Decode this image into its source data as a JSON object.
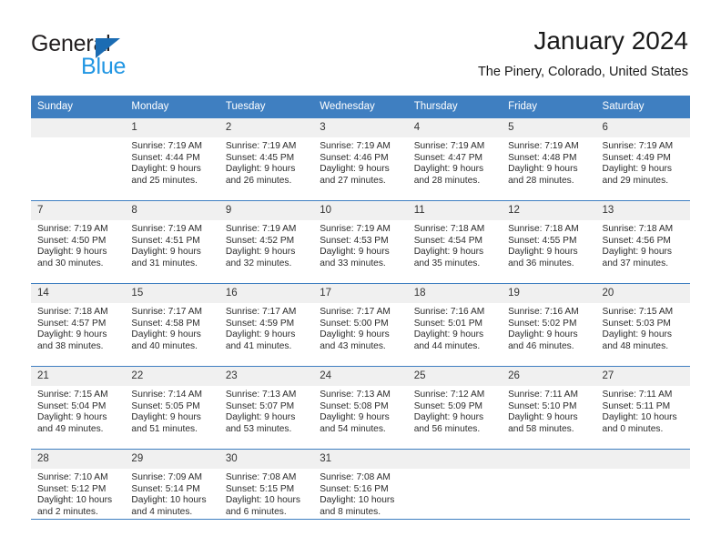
{
  "brand": {
    "name_top": "General",
    "name_bottom": "Blue",
    "accent_color": "#1b6cb3",
    "blue_text_color": "#2196e3"
  },
  "header": {
    "title": "January 2024",
    "subtitle": "The Pinery, Colorado, United States"
  },
  "theme": {
    "header_row_color": "#3f7fc1",
    "daynum_band_color": "#f0f0f0",
    "grid_line_color": "#3f7fc1",
    "text_color": "#2b2b2b"
  },
  "weekday_headers": [
    "Sunday",
    "Monday",
    "Tuesday",
    "Wednesday",
    "Thursday",
    "Friday",
    "Saturday"
  ],
  "weeks": [
    [
      {
        "day": "",
        "sunrise": "",
        "sunset": "",
        "daylight_line1": "",
        "daylight_line2": "",
        "empty": true
      },
      {
        "day": "1",
        "sunrise": "Sunrise: 7:19 AM",
        "sunset": "Sunset: 4:44 PM",
        "daylight_line1": "Daylight: 9 hours",
        "daylight_line2": "and 25 minutes."
      },
      {
        "day": "2",
        "sunrise": "Sunrise: 7:19 AM",
        "sunset": "Sunset: 4:45 PM",
        "daylight_line1": "Daylight: 9 hours",
        "daylight_line2": "and 26 minutes."
      },
      {
        "day": "3",
        "sunrise": "Sunrise: 7:19 AM",
        "sunset": "Sunset: 4:46 PM",
        "daylight_line1": "Daylight: 9 hours",
        "daylight_line2": "and 27 minutes."
      },
      {
        "day": "4",
        "sunrise": "Sunrise: 7:19 AM",
        "sunset": "Sunset: 4:47 PM",
        "daylight_line1": "Daylight: 9 hours",
        "daylight_line2": "and 28 minutes."
      },
      {
        "day": "5",
        "sunrise": "Sunrise: 7:19 AM",
        "sunset": "Sunset: 4:48 PM",
        "daylight_line1": "Daylight: 9 hours",
        "daylight_line2": "and 28 minutes."
      },
      {
        "day": "6",
        "sunrise": "Sunrise: 7:19 AM",
        "sunset": "Sunset: 4:49 PM",
        "daylight_line1": "Daylight: 9 hours",
        "daylight_line2": "and 29 minutes."
      }
    ],
    [
      {
        "day": "7",
        "sunrise": "Sunrise: 7:19 AM",
        "sunset": "Sunset: 4:50 PM",
        "daylight_line1": "Daylight: 9 hours",
        "daylight_line2": "and 30 minutes."
      },
      {
        "day": "8",
        "sunrise": "Sunrise: 7:19 AM",
        "sunset": "Sunset: 4:51 PM",
        "daylight_line1": "Daylight: 9 hours",
        "daylight_line2": "and 31 minutes."
      },
      {
        "day": "9",
        "sunrise": "Sunrise: 7:19 AM",
        "sunset": "Sunset: 4:52 PM",
        "daylight_line1": "Daylight: 9 hours",
        "daylight_line2": "and 32 minutes."
      },
      {
        "day": "10",
        "sunrise": "Sunrise: 7:19 AM",
        "sunset": "Sunset: 4:53 PM",
        "daylight_line1": "Daylight: 9 hours",
        "daylight_line2": "and 33 minutes."
      },
      {
        "day": "11",
        "sunrise": "Sunrise: 7:18 AM",
        "sunset": "Sunset: 4:54 PM",
        "daylight_line1": "Daylight: 9 hours",
        "daylight_line2": "and 35 minutes."
      },
      {
        "day": "12",
        "sunrise": "Sunrise: 7:18 AM",
        "sunset": "Sunset: 4:55 PM",
        "daylight_line1": "Daylight: 9 hours",
        "daylight_line2": "and 36 minutes."
      },
      {
        "day": "13",
        "sunrise": "Sunrise: 7:18 AM",
        "sunset": "Sunset: 4:56 PM",
        "daylight_line1": "Daylight: 9 hours",
        "daylight_line2": "and 37 minutes."
      }
    ],
    [
      {
        "day": "14",
        "sunrise": "Sunrise: 7:18 AM",
        "sunset": "Sunset: 4:57 PM",
        "daylight_line1": "Daylight: 9 hours",
        "daylight_line2": "and 38 minutes."
      },
      {
        "day": "15",
        "sunrise": "Sunrise: 7:17 AM",
        "sunset": "Sunset: 4:58 PM",
        "daylight_line1": "Daylight: 9 hours",
        "daylight_line2": "and 40 minutes."
      },
      {
        "day": "16",
        "sunrise": "Sunrise: 7:17 AM",
        "sunset": "Sunset: 4:59 PM",
        "daylight_line1": "Daylight: 9 hours",
        "daylight_line2": "and 41 minutes."
      },
      {
        "day": "17",
        "sunrise": "Sunrise: 7:17 AM",
        "sunset": "Sunset: 5:00 PM",
        "daylight_line1": "Daylight: 9 hours",
        "daylight_line2": "and 43 minutes."
      },
      {
        "day": "18",
        "sunrise": "Sunrise: 7:16 AM",
        "sunset": "Sunset: 5:01 PM",
        "daylight_line1": "Daylight: 9 hours",
        "daylight_line2": "and 44 minutes."
      },
      {
        "day": "19",
        "sunrise": "Sunrise: 7:16 AM",
        "sunset": "Sunset: 5:02 PM",
        "daylight_line1": "Daylight: 9 hours",
        "daylight_line2": "and 46 minutes."
      },
      {
        "day": "20",
        "sunrise": "Sunrise: 7:15 AM",
        "sunset": "Sunset: 5:03 PM",
        "daylight_line1": "Daylight: 9 hours",
        "daylight_line2": "and 48 minutes."
      }
    ],
    [
      {
        "day": "21",
        "sunrise": "Sunrise: 7:15 AM",
        "sunset": "Sunset: 5:04 PM",
        "daylight_line1": "Daylight: 9 hours",
        "daylight_line2": "and 49 minutes."
      },
      {
        "day": "22",
        "sunrise": "Sunrise: 7:14 AM",
        "sunset": "Sunset: 5:05 PM",
        "daylight_line1": "Daylight: 9 hours",
        "daylight_line2": "and 51 minutes."
      },
      {
        "day": "23",
        "sunrise": "Sunrise: 7:13 AM",
        "sunset": "Sunset: 5:07 PM",
        "daylight_line1": "Daylight: 9 hours",
        "daylight_line2": "and 53 minutes."
      },
      {
        "day": "24",
        "sunrise": "Sunrise: 7:13 AM",
        "sunset": "Sunset: 5:08 PM",
        "daylight_line1": "Daylight: 9 hours",
        "daylight_line2": "and 54 minutes."
      },
      {
        "day": "25",
        "sunrise": "Sunrise: 7:12 AM",
        "sunset": "Sunset: 5:09 PM",
        "daylight_line1": "Daylight: 9 hours",
        "daylight_line2": "and 56 minutes."
      },
      {
        "day": "26",
        "sunrise": "Sunrise: 7:11 AM",
        "sunset": "Sunset: 5:10 PM",
        "daylight_line1": "Daylight: 9 hours",
        "daylight_line2": "and 58 minutes."
      },
      {
        "day": "27",
        "sunrise": "Sunrise: 7:11 AM",
        "sunset": "Sunset: 5:11 PM",
        "daylight_line1": "Daylight: 10 hours",
        "daylight_line2": "and 0 minutes."
      }
    ],
    [
      {
        "day": "28",
        "sunrise": "Sunrise: 7:10 AM",
        "sunset": "Sunset: 5:12 PM",
        "daylight_line1": "Daylight: 10 hours",
        "daylight_line2": "and 2 minutes."
      },
      {
        "day": "29",
        "sunrise": "Sunrise: 7:09 AM",
        "sunset": "Sunset: 5:14 PM",
        "daylight_line1": "Daylight: 10 hours",
        "daylight_line2": "and 4 minutes."
      },
      {
        "day": "30",
        "sunrise": "Sunrise: 7:08 AM",
        "sunset": "Sunset: 5:15 PM",
        "daylight_line1": "Daylight: 10 hours",
        "daylight_line2": "and 6 minutes."
      },
      {
        "day": "31",
        "sunrise": "Sunrise: 7:08 AM",
        "sunset": "Sunset: 5:16 PM",
        "daylight_line1": "Daylight: 10 hours",
        "daylight_line2": "and 8 minutes."
      },
      {
        "day": "",
        "sunrise": "",
        "sunset": "",
        "daylight_line1": "",
        "daylight_line2": "",
        "empty": true
      },
      {
        "day": "",
        "sunrise": "",
        "sunset": "",
        "daylight_line1": "",
        "daylight_line2": "",
        "empty": true
      },
      {
        "day": "",
        "sunrise": "",
        "sunset": "",
        "daylight_line1": "",
        "daylight_line2": "",
        "empty": true
      }
    ]
  ]
}
